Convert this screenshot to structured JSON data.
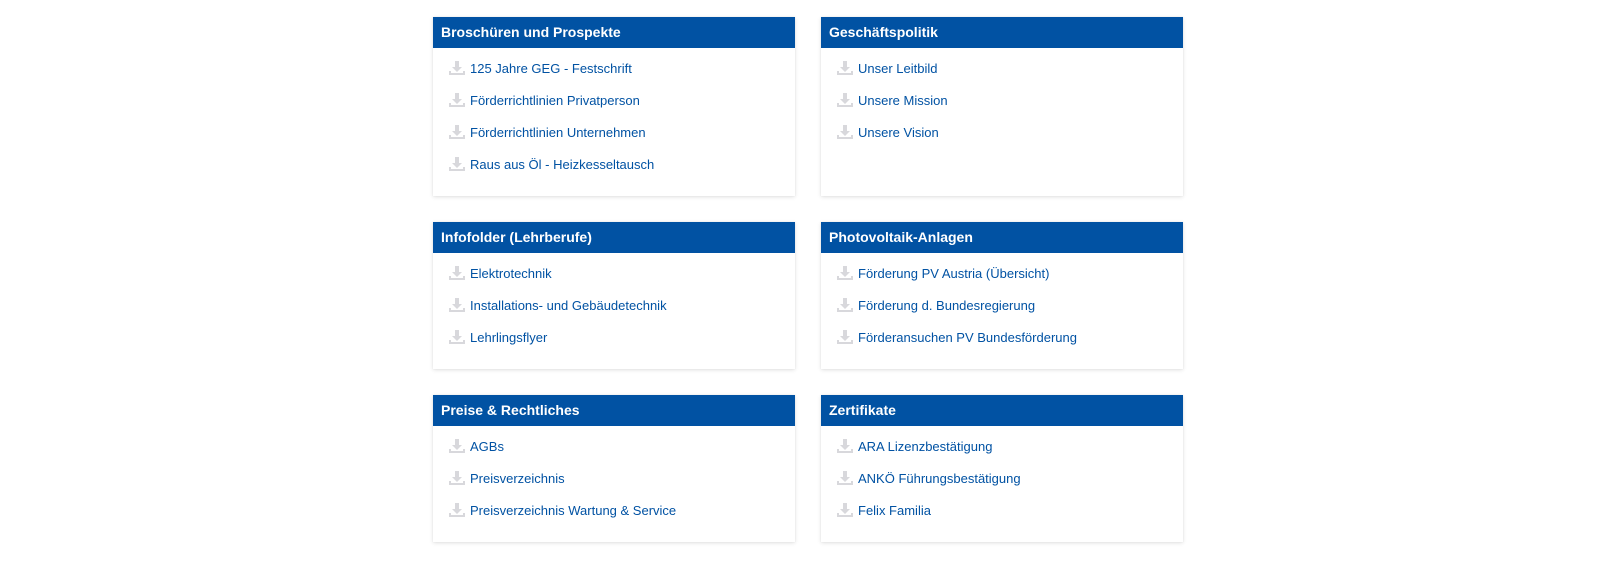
{
  "colors": {
    "header_bg": "#0152a3",
    "link": "#0152a3",
    "icon": "#d8d8dc"
  },
  "icon_name": "download-icon",
  "cards": [
    {
      "title": "Broschüren und Prospekte",
      "items": [
        "125 Jahre GEG - Festschrift",
        "Förderrichtlinien Privatperson",
        "Förderrichtlinien Unternehmen",
        "Raus aus Öl - Heizkesseltausch"
      ]
    },
    {
      "title": "Geschäftspolitik",
      "items": [
        "Unser Leitbild",
        "Unsere Mission",
        "Unsere Vision"
      ]
    },
    {
      "title": "Infofolder (Lehrberufe)",
      "items": [
        "Elektrotechnik",
        "Installations- und Gebäudetechnik",
        "Lehrlingsflyer"
      ]
    },
    {
      "title": "Photovoltaik-Anlagen",
      "items": [
        "Förderung PV Austria (Übersicht)",
        "Förderung d. Bundesregierung",
        "Förderansuchen PV Bundesförderung"
      ]
    },
    {
      "title": "Preise & Rechtliches",
      "items": [
        "AGBs",
        "Preisverzeichnis",
        "Preisverzeichnis Wartung & Service"
      ]
    },
    {
      "title": "Zertifikate",
      "items": [
        "ARA Lizenzbestätigung",
        "ANKÖ Führungsbestätigung",
        "Felix Familia"
      ]
    }
  ]
}
